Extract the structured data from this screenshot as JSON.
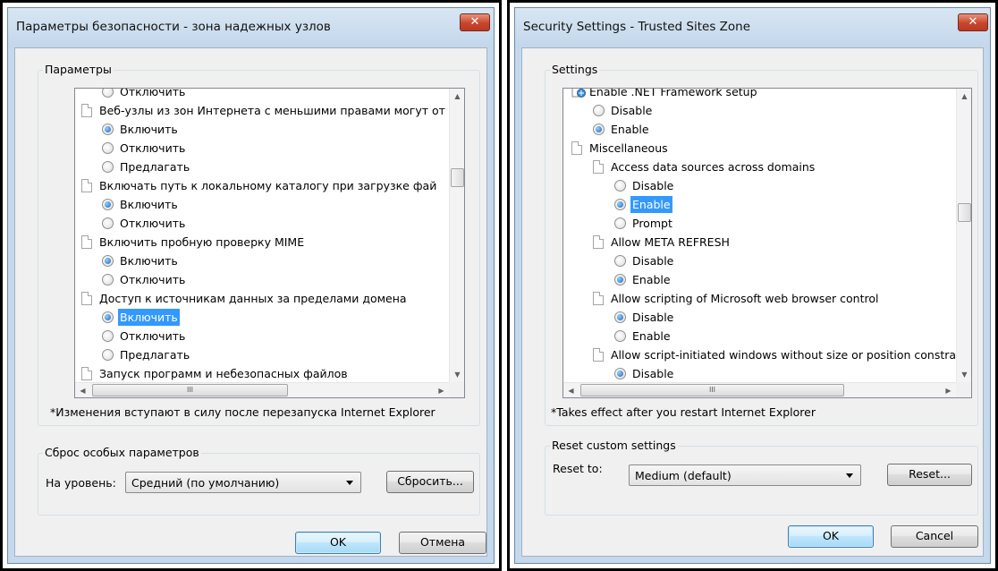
{
  "left": {
    "title": "Параметры безопасности - зона надежных узлов",
    "close": "✕",
    "settings_label": "Параметры",
    "rows": [
      {
        "type": "radio",
        "label": "Отключить",
        "checked": false
      },
      {
        "type": "page",
        "label": "Веб-узлы из зон Интернета с меньшими правами могут от"
      },
      {
        "type": "radio",
        "label": "Включить",
        "checked": true
      },
      {
        "type": "radio",
        "label": "Отключить",
        "checked": false
      },
      {
        "type": "radio",
        "label": "Предлагать",
        "checked": false
      },
      {
        "type": "page",
        "label": "Включать путь к локальному каталогу при загрузке фай"
      },
      {
        "type": "radio",
        "label": "Включить",
        "checked": true
      },
      {
        "type": "radio",
        "label": "Отключить",
        "checked": false
      },
      {
        "type": "page",
        "label": "Включить пробную проверку MIME"
      },
      {
        "type": "radio",
        "label": "Включить",
        "checked": true
      },
      {
        "type": "radio",
        "label": "Отключить",
        "checked": false
      },
      {
        "type": "page",
        "label": "Доступ к источникам данных за пределами домена"
      },
      {
        "type": "radio",
        "label": "Включить",
        "checked": true,
        "selected": true
      },
      {
        "type": "radio",
        "label": "Отключить",
        "checked": false
      },
      {
        "type": "radio",
        "label": "Предлагать",
        "checked": false
      },
      {
        "type": "page",
        "label": "Запуск программ и небезопасных файлов"
      }
    ],
    "note": "*Изменения вступают в силу после перезапуска Internet Explorer",
    "reset_group_label": "Сброс особых параметров",
    "reset_to_label": "На уровень:",
    "reset_level": "Средний (по умолчанию)",
    "reset_button": "Сбросить...",
    "ok_button": "OK",
    "cancel_button": "Отмена",
    "hscroll_grip": "III"
  },
  "right": {
    "title": "Security Settings - Trusted Sites Zone",
    "close": "✕",
    "settings_label": "Settings",
    "rows": [
      {
        "type": "net",
        "label": "Enable .NET Framework setup",
        "indent": 0
      },
      {
        "type": "radio",
        "label": "Disable",
        "checked": false,
        "indent": 1
      },
      {
        "type": "radio",
        "label": "Enable",
        "checked": true,
        "indent": 1
      },
      {
        "type": "page",
        "label": "Miscellaneous",
        "indent": 0
      },
      {
        "type": "page",
        "label": "Access data sources across domains",
        "indent": 1
      },
      {
        "type": "radio",
        "label": "Disable",
        "checked": false,
        "indent": 2
      },
      {
        "type": "radio",
        "label": "Enable",
        "checked": true,
        "indent": 2,
        "selected": true
      },
      {
        "type": "radio",
        "label": "Prompt",
        "checked": false,
        "indent": 2
      },
      {
        "type": "page",
        "label": "Allow META REFRESH",
        "indent": 1
      },
      {
        "type": "radio",
        "label": "Disable",
        "checked": false,
        "indent": 2
      },
      {
        "type": "radio",
        "label": "Enable",
        "checked": true,
        "indent": 2
      },
      {
        "type": "page",
        "label": "Allow scripting of Microsoft web browser control",
        "indent": 1
      },
      {
        "type": "radio",
        "label": "Disable",
        "checked": true,
        "indent": 2
      },
      {
        "type": "radio",
        "label": "Enable",
        "checked": false,
        "indent": 2
      },
      {
        "type": "page",
        "label": "Allow script-initiated windows without size or position constra",
        "indent": 1
      },
      {
        "type": "radio",
        "label": "Disable",
        "checked": true,
        "indent": 2
      }
    ],
    "note": "*Takes effect after you restart Internet Explorer",
    "reset_group_label": "Reset custom settings",
    "reset_to_label": "Reset to:",
    "reset_level": "Medium (default)",
    "reset_button": "Reset...",
    "ok_button": "OK",
    "cancel_button": "Cancel",
    "hscroll_grip": "III"
  }
}
